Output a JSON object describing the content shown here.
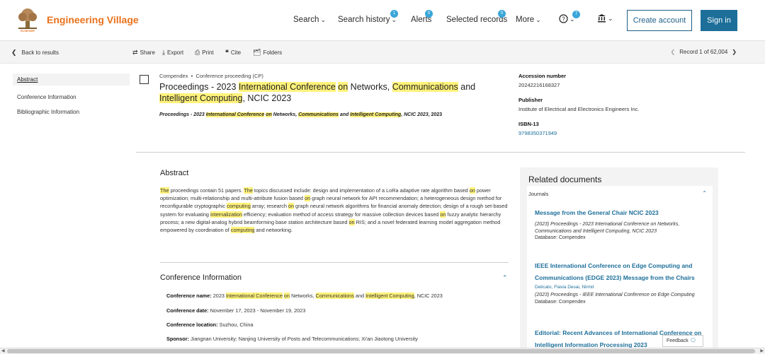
{
  "header": {
    "brand": "Engineering Village",
    "logo_text": "ELSEVIER",
    "nav": {
      "search": "Search",
      "search_history": "Search history",
      "alerts": "Alerts",
      "selected_records": "Selected records",
      "more": "More"
    },
    "badges": {
      "search_history": "1",
      "alerts": "0",
      "selected_records": "0",
      "help": "7"
    },
    "create_account": "Create account",
    "sign_in": "Sign in"
  },
  "toolbar": {
    "back": "Back to results",
    "share": "Share",
    "export": "Export",
    "print": "Print",
    "cite": "Cite",
    "folders": "Folders",
    "record_position": "Record 1 of 62,004"
  },
  "sidenav": {
    "abstract": "Abstract",
    "conference": "Conference Information",
    "bibliographic": "Bibliographic Information"
  },
  "record": {
    "database": "Compendex",
    "doc_type": "Conference proceeding (CP)",
    "title": {
      "t1": "Proceedings - 2023 ",
      "h1": "International Conference",
      "t2": " ",
      "h2": "on",
      "t3": " Networks, ",
      "h3": "Communications",
      "t4": " and ",
      "h4": "Intelligent Computing",
      "t5": ", NCIC 2023"
    },
    "source": {
      "t1": "Proceedings - 2023 ",
      "h1": "International Conference",
      "t2": " ",
      "h2": "on",
      "t3": " Networks, ",
      "h3": "Communications",
      "t4": " and ",
      "h4": "Intelligent Computing",
      "t5": ", NCIC 2023",
      "year": ", 2023"
    },
    "accession_label": "Accession number",
    "accession_value": "20242216168327",
    "publisher_label": "Publisher",
    "publisher_value": "Institute of Electrical and Electronics Engineers Inc.",
    "isbn_label": "ISBN-13",
    "isbn_value": "9798350371949"
  },
  "abstract": {
    "heading": "Abstract",
    "p": {
      "h1": "The",
      "t1": " proceedings contain 51 papers. ",
      "h2": "The",
      "t2": " topics discussed include: design and implementation of a LoRa adaptive rate algorithm based ",
      "h3": "on",
      "t3": " power optimization; multi-relationship and multi-attribute fusion based ",
      "h4": "on",
      "t4": " graph neural network for API recommendation; a heterogeneous design method for reconfigurable cryptographic ",
      "h5": "computing",
      "t5": " array; research ",
      "h6": "on",
      "t6": " graph neural network algorithms for financial anomaly detection; design of a rough set-based system for evaluating ",
      "h7": "internalization",
      "t7": " efficiency; evaluation method of access strategy for massive collection devices based ",
      "h8": "on",
      "t8": " fuzzy analytic hierarchy process; a new digital-analog hybrid beamforming base station architecture based ",
      "h9": "on",
      "t9": " RIS; and a novel federated learning model aggregation method empowered by coordination of ",
      "h10": "computing",
      "t10": " and networking."
    }
  },
  "conference": {
    "heading": "Conference Information",
    "name_label": "Conference name:",
    "name": {
      "t1": " 2023 ",
      "h1": "International Conference",
      "t2": " ",
      "h2": "on",
      "t3": " Networks, ",
      "h3": "Communications",
      "t4": " and ",
      "h4": "Intelligent Computing",
      "t5": ", NCIC 2023"
    },
    "date_label": "Conference date:",
    "date_value": " November 17, 2023 - November 19, 2023",
    "location_label": "Conference location:",
    "location_value": " Suzhou, China",
    "sponsor_label": "Sponsor:",
    "sponsor_value": " Jiangnan University; Nanjing University of Posts and Telecommunications; Xi'an Jiaotong University"
  },
  "related": {
    "heading": "Related documents",
    "category": "Journals",
    "item1": {
      "title": "Message from the General Chair NCIC 2023",
      "citation": "(2023) Proceedings - 2023 International Conference on Networks, Communications and Intelligent Computing, NCIC 2023",
      "database": "Database: Compendex"
    },
    "item2": {
      "title": "IEEE International Conference on Edge Computing and Communications (EDGE 2023) Message from the Chairs",
      "authors": "Delicato, Flavia Desai, Nirmit",
      "citation": "(2023) Proceedings - IEEE International Conference on Edge Computing",
      "database": "Database: Compendex"
    },
    "item3": {
      "title": "Editorial: Recent Advances of International Conference on Intelligent Information Processing 2023"
    }
  },
  "feedback": "Feedback"
}
